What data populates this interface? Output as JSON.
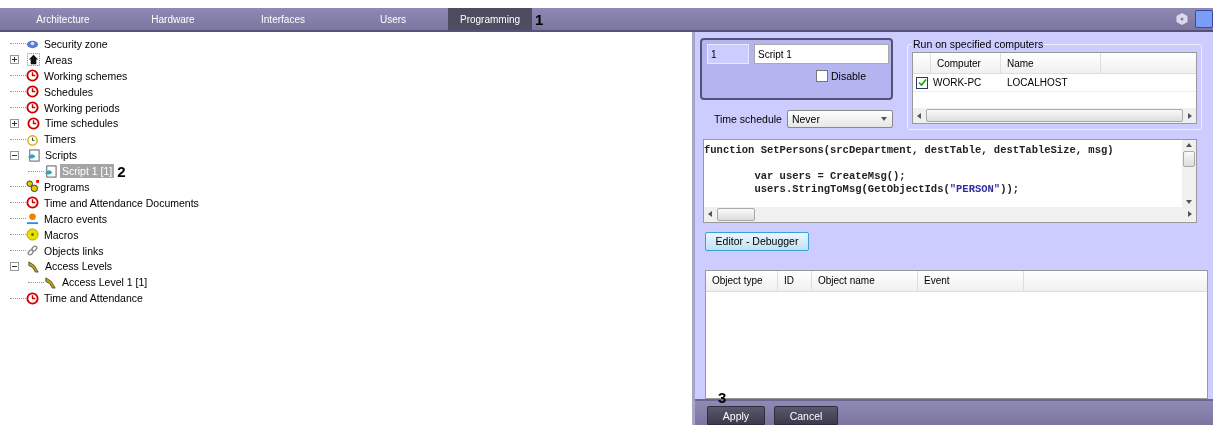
{
  "tabs": [
    {
      "label": "Architecture",
      "selected": false
    },
    {
      "label": "Hardware",
      "selected": false
    },
    {
      "label": "Interfaces",
      "selected": false
    },
    {
      "label": "Users",
      "selected": false
    },
    {
      "label": "Programming",
      "selected": true,
      "callout": "1"
    }
  ],
  "tree": [
    {
      "kind": "zone",
      "label": "Security zone",
      "selected": false
    },
    {
      "kind": "area",
      "label": "Areas",
      "selected": false,
      "expanded": false
    },
    {
      "kind": "clock",
      "label": "Working schemes",
      "selected": false
    },
    {
      "kind": "clock",
      "label": "Schedules",
      "selected": false
    },
    {
      "kind": "clock",
      "label": "Working periods",
      "selected": false
    },
    {
      "kind": "clock",
      "label": "Time schedules",
      "selected": false,
      "expanded": false
    },
    {
      "kind": "timer",
      "label": "Timers",
      "selected": false
    },
    {
      "kind": "script",
      "label": "Scripts",
      "selected": false,
      "expanded": true,
      "children": [
        {
          "kind": "script",
          "label": "Script 1 [1]",
          "selected": true,
          "callout": "2"
        }
      ]
    },
    {
      "kind": "program",
      "label": "Programs",
      "selected": false
    },
    {
      "kind": "clock",
      "label": "Time and Attendance Documents",
      "selected": false
    },
    {
      "kind": "event",
      "label": "Macro events",
      "selected": false
    },
    {
      "kind": "macro",
      "label": "Macros",
      "selected": false
    },
    {
      "kind": "link",
      "label": "Objects links",
      "selected": false
    },
    {
      "kind": "access",
      "label": "Access Levels",
      "selected": false,
      "expanded": true,
      "children": [
        {
          "kind": "access",
          "label": "Access Level 1 [1]",
          "selected": false
        }
      ]
    },
    {
      "kind": "clock",
      "label": "Time and Attendance",
      "selected": false
    }
  ],
  "script": {
    "id": "1",
    "name": "Script 1",
    "disable": {
      "label": "Disable",
      "checked": false
    }
  },
  "time_schedule": {
    "label": "Time schedule",
    "value": "Never"
  },
  "computers": {
    "title": "Run on specified computers",
    "columns": [
      "Computer",
      "Name"
    ],
    "rows": [
      {
        "checked": true,
        "computer": "WORK-PC",
        "name": "LOCALHOST"
      }
    ]
  },
  "code": [
    [
      {
        "t": "function SetPersons(srcDepartment, destTable, destTableSize, msg)",
        "kind": "plain"
      }
    ],
    [
      {
        "t": "        var users = ",
        "kind": "plain",
        "space_before": true
      },
      {
        "t": "CreateMsg",
        "kind": "bold"
      },
      {
        "t": "();",
        "kind": "plain"
      }
    ],
    [
      {
        "t": "        users.StringToMsg(GetObjectIds(",
        "kind": "plain"
      },
      {
        "t": "\"PERSON\"",
        "kind": "string"
      },
      {
        "t": "));",
        "kind": "plain"
      }
    ]
  ],
  "editor_button": "Editor - Debugger",
  "events_table": {
    "columns": [
      "Object type",
      "ID",
      "Object name",
      "Event"
    ]
  },
  "buttons": [
    {
      "label": "Apply",
      "callout": "3"
    },
    {
      "label": "Cancel"
    }
  ]
}
